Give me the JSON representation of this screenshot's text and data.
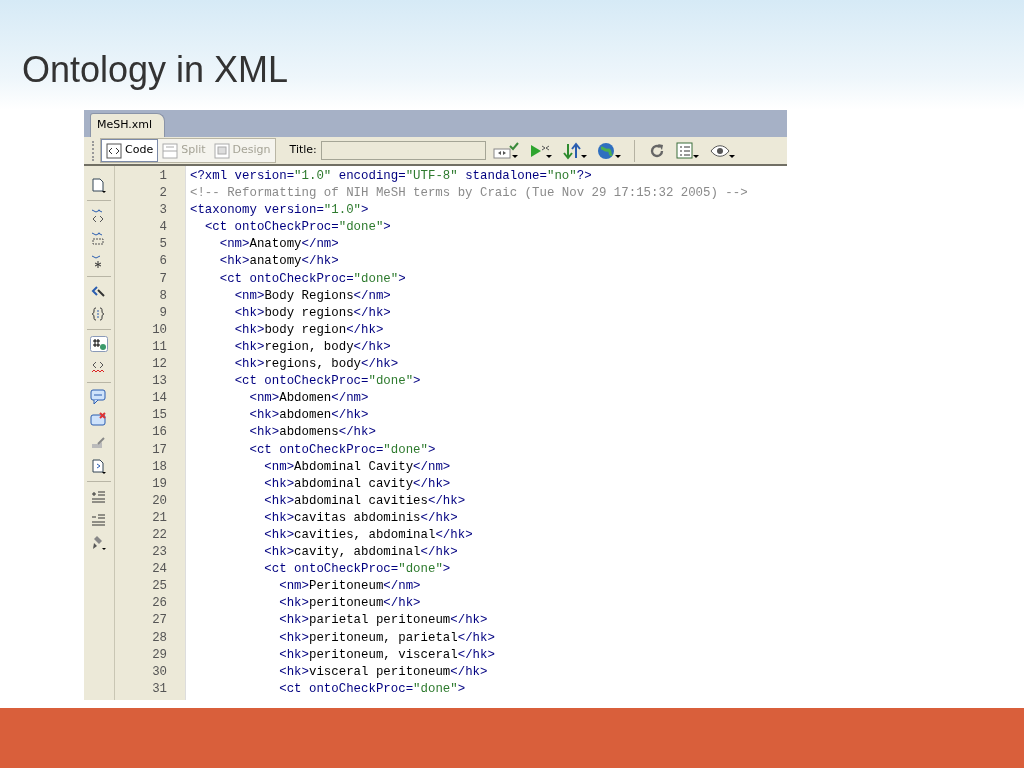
{
  "slide_title": "Ontology in XML",
  "editor": {
    "tabs": [
      {
        "label": "MeSH.xml",
        "selected": true
      }
    ],
    "view_buttons": [
      {
        "label": "Code",
        "selected": true
      },
      {
        "label": "Split",
        "selected": false
      },
      {
        "label": "Design",
        "selected": false
      }
    ],
    "title_label": "Title:",
    "lines": [
      {
        "number": "1",
        "kind": "markup",
        "text": "<?xml version=\"1.0\" encoding=\"UTF-8\" standalone=\"no\"?>"
      },
      {
        "number": "2",
        "kind": "comment",
        "text": "<!-- Reformatting of NIH MeSH terms by Craic (Tue Nov 29 17:15:32 2005) -->"
      },
      {
        "number": "3",
        "kind": "markup",
        "text": "<taxonomy version=\"1.0\">"
      },
      {
        "number": "4",
        "kind": "markup",
        "text": "  <ct ontoCheckProc=\"done\">"
      },
      {
        "number": "5",
        "kind": "markup",
        "text": "    <nm>Anatomy</nm>"
      },
      {
        "number": "6",
        "kind": "markup",
        "text": "    <hk>anatomy</hk>"
      },
      {
        "number": "7",
        "kind": "markup",
        "text": "    <ct ontoCheckProc=\"done\">"
      },
      {
        "number": "8",
        "kind": "markup",
        "text": "      <nm>Body Regions</nm>"
      },
      {
        "number": "9",
        "kind": "markup",
        "text": "      <hk>body regions</hk>"
      },
      {
        "number": "10",
        "kind": "markup",
        "text": "      <hk>body region</hk>"
      },
      {
        "number": "11",
        "kind": "markup",
        "text": "      <hk>region, body</hk>"
      },
      {
        "number": "12",
        "kind": "markup",
        "text": "      <hk>regions, body</hk>"
      },
      {
        "number": "13",
        "kind": "markup",
        "text": "      <ct ontoCheckProc=\"done\">"
      },
      {
        "number": "14",
        "kind": "markup",
        "text": "        <nm>Abdomen</nm>"
      },
      {
        "number": "15",
        "kind": "markup",
        "text": "        <hk>abdomen</hk>"
      },
      {
        "number": "16",
        "kind": "markup",
        "text": "        <hk>abdomens</hk>"
      },
      {
        "number": "17",
        "kind": "markup",
        "text": "        <ct ontoCheckProc=\"done\">"
      },
      {
        "number": "18",
        "kind": "markup",
        "text": "          <nm>Abdominal Cavity</nm>"
      },
      {
        "number": "19",
        "kind": "markup",
        "text": "          <hk>abdominal cavity</hk>"
      },
      {
        "number": "20",
        "kind": "markup",
        "text": "          <hk>abdominal cavities</hk>"
      },
      {
        "number": "21",
        "kind": "markup",
        "text": "          <hk>cavitas abdominis</hk>"
      },
      {
        "number": "22",
        "kind": "markup",
        "text": "          <hk>cavities, abdominal</hk>"
      },
      {
        "number": "23",
        "kind": "markup",
        "text": "          <hk>cavity, abdominal</hk>"
      },
      {
        "number": "24",
        "kind": "markup",
        "text": "          <ct ontoCheckProc=\"done\">"
      },
      {
        "number": "25",
        "kind": "markup",
        "text": "            <nm>Peritoneum</nm>"
      },
      {
        "number": "26",
        "kind": "markup",
        "text": "            <hk>peritoneum</hk>"
      },
      {
        "number": "27",
        "kind": "markup",
        "text": "            <hk>parietal peritoneum</hk>"
      },
      {
        "number": "28",
        "kind": "markup",
        "text": "            <hk>peritoneum, parietal</hk>"
      },
      {
        "number": "29",
        "kind": "markup",
        "text": "            <hk>peritoneum, visceral</hk>"
      },
      {
        "number": "30",
        "kind": "markup",
        "text": "            <hk>visceral peritoneum</hk>"
      },
      {
        "number": "31",
        "kind": "markup",
        "text": "            <ct ontoCheckProc=\"done\">"
      }
    ]
  }
}
